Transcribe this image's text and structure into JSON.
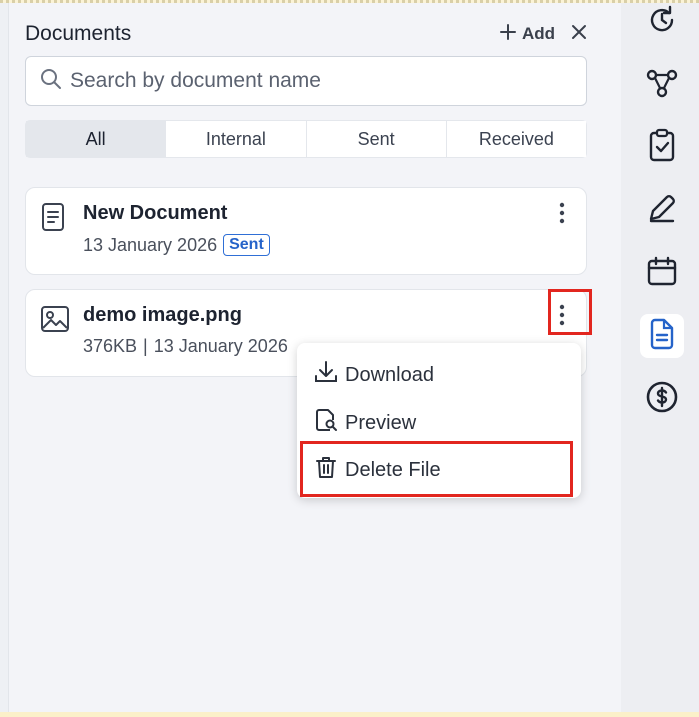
{
  "panel": {
    "title": "Documents",
    "add_label": "Add",
    "colors": {
      "accent": "#2563c9",
      "highlight": "#e2261f"
    }
  },
  "search": {
    "placeholder": "Search by document name",
    "value": ""
  },
  "tabs": [
    {
      "label": "All",
      "active": true
    },
    {
      "label": "Internal",
      "active": false
    },
    {
      "label": "Sent",
      "active": false
    },
    {
      "label": "Received",
      "active": false
    }
  ],
  "documents": [
    {
      "name": "New Document",
      "date": "13 January 2026",
      "badge": "Sent",
      "icon": "document-icon"
    },
    {
      "name": "demo image.png",
      "size": "376KB",
      "separator": "|",
      "date": "13 January 2026",
      "icon": "image-icon"
    }
  ],
  "context_menu": {
    "items": [
      {
        "label": "Download",
        "icon": "download-icon"
      },
      {
        "label": "Preview",
        "icon": "preview-icon"
      },
      {
        "label": "Delete File",
        "icon": "trash-icon"
      }
    ]
  },
  "right_rail": {
    "items": [
      {
        "icon": "clock-refresh-icon",
        "active": false
      },
      {
        "icon": "workflow-icon",
        "active": false
      },
      {
        "icon": "clipboard-check-icon",
        "active": false
      },
      {
        "icon": "pen-icon",
        "active": false
      },
      {
        "icon": "calendar-icon",
        "active": false
      },
      {
        "icon": "document-icon",
        "active": true
      },
      {
        "icon": "dollar-circle-icon",
        "active": false
      }
    ]
  }
}
